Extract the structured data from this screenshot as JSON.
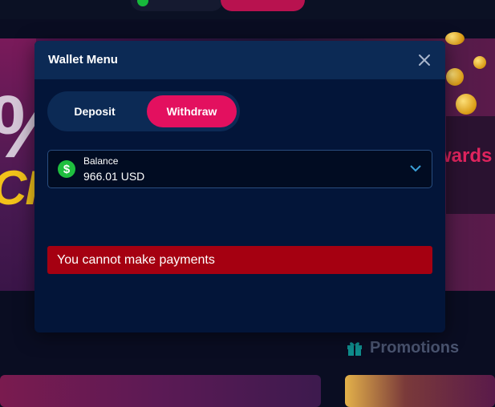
{
  "modal": {
    "title": "Wallet Menu",
    "tabs": [
      {
        "label": "Deposit",
        "active": false
      },
      {
        "label": "Withdraw",
        "active": true
      }
    ],
    "balance": {
      "label": "Balance",
      "value": "966.01 USD",
      "icon": "dollar-icon"
    },
    "error_message": "You cannot make payments"
  },
  "background": {
    "promotions_label": "Promotions",
    "rewards_fragment": "wards",
    "hero_fragment": "CK"
  },
  "colors": {
    "accent": "#e3105f",
    "modal_bg": "#031539",
    "header_bg": "#0c2a55",
    "error_bg": "#a50011",
    "success_green": "#1fbf3f"
  }
}
